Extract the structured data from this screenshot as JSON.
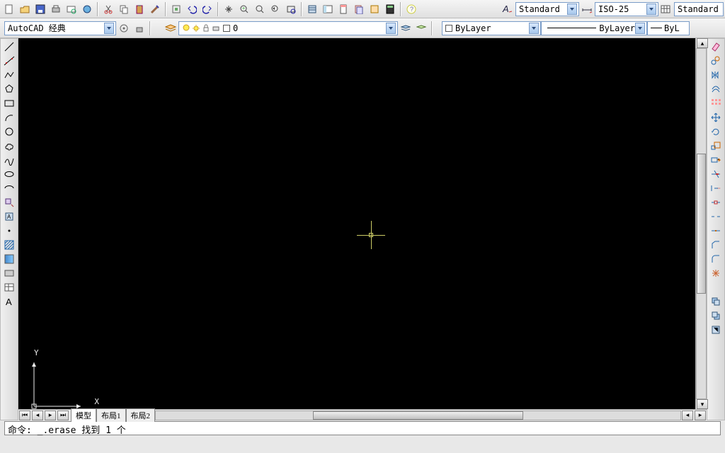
{
  "top_toolbar": {
    "style_label": "Standard",
    "dim_style_label": "ISO-25",
    "table_style_label": "Standard"
  },
  "row2": {
    "workspace": "AutoCAD 经典",
    "layer_name": "0",
    "color": "ByLayer",
    "linetype": "ByLayer",
    "lineweight_abbrev": "ByL"
  },
  "tabs": {
    "model": "模型",
    "layout1": "布局1",
    "layout2": "布局2"
  },
  "ucs": {
    "x": "X",
    "y": "Y"
  },
  "command": "命令: _.erase 找到 1 个",
  "colors": {
    "accent": "#7a9cc8",
    "canvas": "#000000"
  }
}
